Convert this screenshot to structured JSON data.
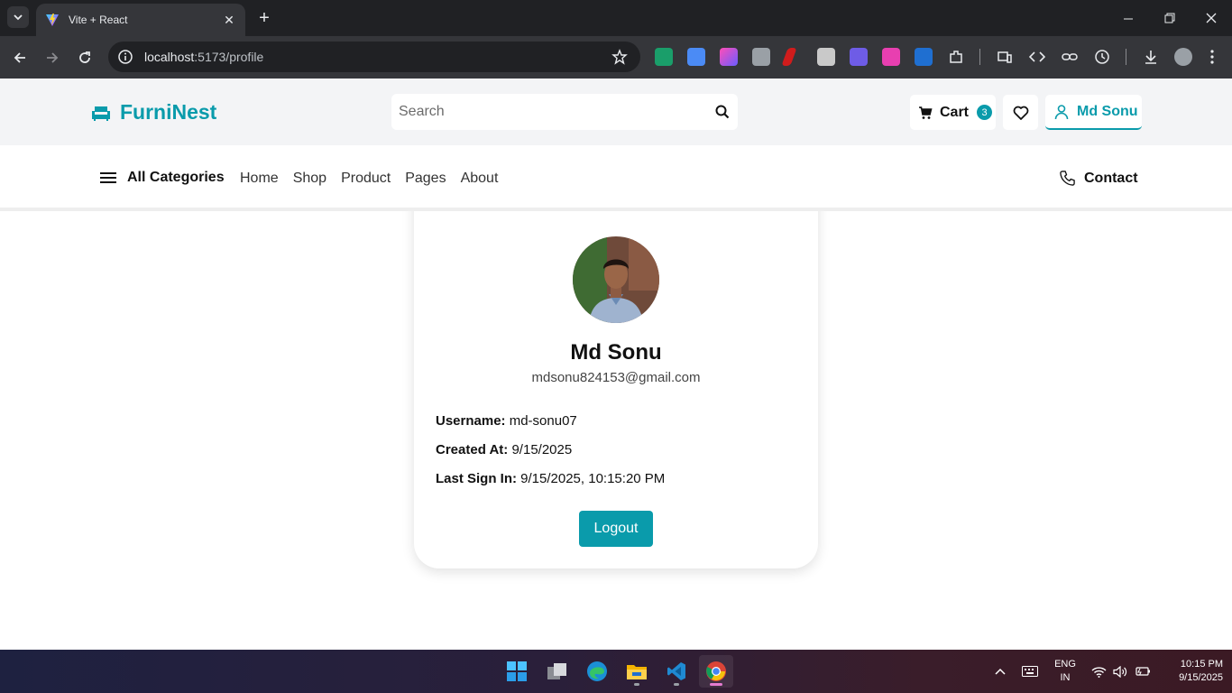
{
  "browser": {
    "tab_title": "Vite + React",
    "url_host": "localhost",
    "url_path": ":5173/profile",
    "icons": [
      "tab-list-icon",
      "vite-favicon",
      "close-icon",
      "plus-icon",
      "minimize-icon",
      "restore-icon",
      "close-window-icon",
      "back-icon",
      "forward-icon",
      "reload-icon",
      "info-icon",
      "star-icon"
    ]
  },
  "header": {
    "brand": "FurniNest",
    "search_placeholder": "Search",
    "cart_label": "Cart",
    "cart_count": "3",
    "user_label": "Md Sonu",
    "accent": "#0a9bab"
  },
  "nav": {
    "categories_label": "All Categories",
    "links": [
      "Home",
      "Shop",
      "Product",
      "Pages",
      "About"
    ],
    "contact_label": "Contact"
  },
  "profile": {
    "name": "Md Sonu",
    "email": "mdsonu824153@gmail.com",
    "username_label": "Username:",
    "username": "md-sonu07",
    "created_label": "Created At:",
    "created": "9/15/2025",
    "signin_label": "Last Sign In:",
    "signin": "9/15/2025, 10:15:20 PM",
    "logout_label": "Logout"
  },
  "taskbar": {
    "lang_line1": "ENG",
    "lang_line2": "IN",
    "time": "10:15 PM",
    "date": "9/15/2025"
  }
}
